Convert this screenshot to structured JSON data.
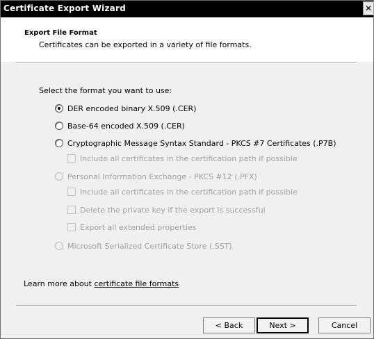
{
  "window": {
    "title": "Certificate Export Wizard",
    "close_glyph": "✕"
  },
  "header": {
    "title": "Export File Format",
    "subtitle": "Certificates can be exported in a variety of file formats."
  },
  "prompt": "Select the format you want to use:",
  "options": [
    {
      "label": "DER encoded binary X.509 (.CER)",
      "type": "radio",
      "checked": true,
      "enabled": true
    },
    {
      "label": "Base-64 encoded X.509 (.CER)",
      "type": "radio",
      "checked": false,
      "enabled": true
    },
    {
      "label": "Cryptographic Message Syntax Standard - PKCS #7 Certificates (.P7B)",
      "type": "radio",
      "checked": false,
      "enabled": true
    },
    {
      "label": "Include all certificates in the certification path if possible",
      "type": "checkbox",
      "checked": false,
      "enabled": false
    },
    {
      "label": "Personal Information Exchange - PKCS #12 (.PFX)",
      "type": "radio",
      "checked": false,
      "enabled": false
    },
    {
      "label": "Include all certificates in the certification path if possible",
      "type": "checkbox",
      "checked": false,
      "enabled": false
    },
    {
      "label": "Delete the private key if the export is successful",
      "type": "checkbox",
      "checked": false,
      "enabled": false
    },
    {
      "label": "Export all extended properties",
      "type": "checkbox",
      "checked": false,
      "enabled": false
    },
    {
      "label": "Microsoft Serialized Certificate Store (.SST)",
      "type": "radio",
      "checked": false,
      "enabled": false
    }
  ],
  "learn_more": {
    "prefix": "Learn more about ",
    "link": "certificate file formats"
  },
  "buttons": {
    "back": "< Back",
    "next": "Next >",
    "cancel": "Cancel"
  }
}
